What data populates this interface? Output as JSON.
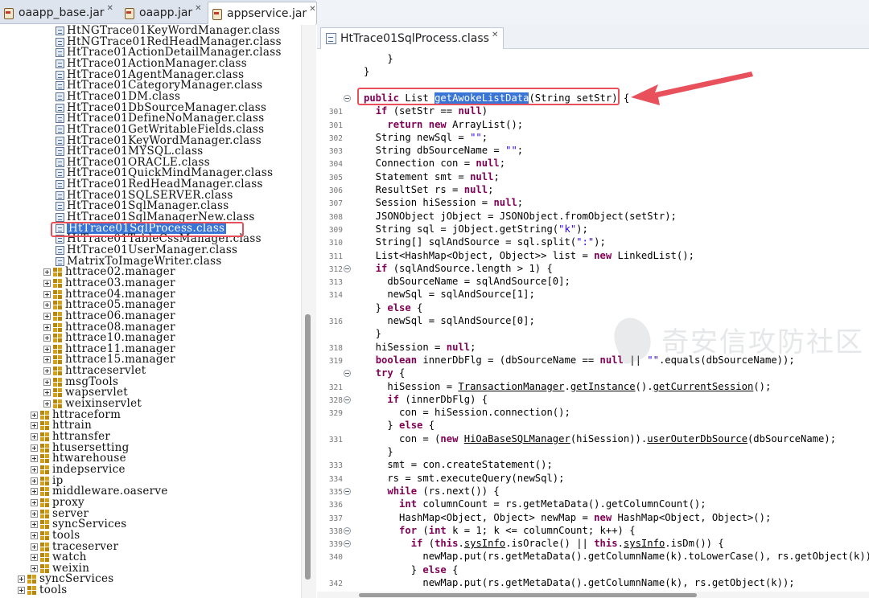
{
  "top_tabs": [
    {
      "label": "oaapp_base.jar",
      "active": false
    },
    {
      "label": "oaapp.jar",
      "active": false
    },
    {
      "label": "appservice.jar",
      "active": true
    }
  ],
  "tree": {
    "class_items": [
      "HtNGTrace01KeyWordManager.class",
      "HtNGTrace01RedHeadManager.class",
      "HtTrace01ActionDetailManager.class",
      "HtTrace01ActionManager.class",
      "HtTrace01AgentManager.class",
      "HtTrace01CategoryManager.class",
      "HtTrace01DM.class",
      "HtTrace01DbSourceManager.class",
      "HtTrace01DefineNoManager.class",
      "HtTrace01GetWritableFields.class",
      "HtTrace01KeyWordManager.class",
      "HtTrace01MYSQL.class",
      "HtTrace01ORACLE.class",
      "HtTrace01QuickMindManager.class",
      "HtTrace01RedHeadManager.class",
      "HtTrace01SQLSERVER.class",
      "HtTrace01SqlManager.class",
      "HtTrace01SqlManagerNew.class",
      "HtTrace01SqlProcess.class",
      "HtTrace01TableCssManager.class",
      "HtTrace01UserManager.class",
      "MatrixToImageWriter.class"
    ],
    "selected_class": "HtTrace01SqlProcess.class",
    "subpackages": [
      "httrace02.manager",
      "httrace03.manager",
      "httrace04.manager",
      "httrace05.manager",
      "httrace06.manager",
      "httrace08.manager",
      "httrace10.manager",
      "httrace11.manager",
      "httrace15.manager",
      "httraceservlet",
      "msgTools",
      "wapservlet",
      "weixinservlet"
    ],
    "packages": [
      "httraceform",
      "httrain",
      "httransfer",
      "htusersetting",
      "htwarehouse",
      "indepservice",
      "ip",
      "middleware.oaserve",
      "proxy",
      "server",
      "syncServices",
      "tools",
      "traceserver",
      "watch",
      "weixin"
    ],
    "root_packages": [
      "syncServices",
      "tools"
    ]
  },
  "editor": {
    "tab_label": "HtTrace01SqlProcess.class",
    "lines": [
      {
        "num": "",
        "fold": false,
        "code": [
          {
            "t": "    }"
          }
        ]
      },
      {
        "num": "",
        "fold": false,
        "code": [
          {
            "t": "}"
          }
        ]
      },
      {
        "num": "",
        "fold": false,
        "code": [
          {
            "t": ""
          }
        ]
      },
      {
        "num": "",
        "fold": true,
        "code": [
          {
            "t": "public",
            "c": "kw"
          },
          {
            "t": " List "
          },
          {
            "t": "getAwokeListData",
            "c": "hl"
          },
          {
            "t": "(String setStr) {"
          }
        ]
      },
      {
        "num": "301",
        "fold": false,
        "code": [
          {
            "t": "  "
          },
          {
            "t": "if",
            "c": "kw"
          },
          {
            "t": " (setStr == "
          },
          {
            "t": "null",
            "c": "kw"
          },
          {
            "t": ")"
          }
        ]
      },
      {
        "num": "301",
        "fold": false,
        "code": [
          {
            "t": "    "
          },
          {
            "t": "return",
            "c": "kw"
          },
          {
            "t": " "
          },
          {
            "t": "new",
            "c": "kw"
          },
          {
            "t": " ArrayList();"
          }
        ]
      },
      {
        "num": "302",
        "fold": false,
        "code": [
          {
            "t": "  String newSql = "
          },
          {
            "t": "\"\"",
            "c": "str"
          },
          {
            "t": ";"
          }
        ]
      },
      {
        "num": "303",
        "fold": false,
        "code": [
          {
            "t": "  String dbSourceName = "
          },
          {
            "t": "\"\"",
            "c": "str"
          },
          {
            "t": ";"
          }
        ]
      },
      {
        "num": "304",
        "fold": false,
        "code": [
          {
            "t": "  Connection con = "
          },
          {
            "t": "null",
            "c": "kw"
          },
          {
            "t": ";"
          }
        ]
      },
      {
        "num": "305",
        "fold": false,
        "code": [
          {
            "t": "  Statement smt = "
          },
          {
            "t": "null",
            "c": "kw"
          },
          {
            "t": ";"
          }
        ]
      },
      {
        "num": "306",
        "fold": false,
        "code": [
          {
            "t": "  ResultSet rs = "
          },
          {
            "t": "null",
            "c": "kw"
          },
          {
            "t": ";"
          }
        ]
      },
      {
        "num": "307",
        "fold": false,
        "code": [
          {
            "t": "  Session hiSession = "
          },
          {
            "t": "null",
            "c": "kw"
          },
          {
            "t": ";"
          }
        ]
      },
      {
        "num": "308",
        "fold": false,
        "code": [
          {
            "t": "  JSONObject jObject = JSONObject.fromObject(setStr);"
          }
        ]
      },
      {
        "num": "309",
        "fold": false,
        "code": [
          {
            "t": "  String sql = jObject.getString("
          },
          {
            "t": "\"k\"",
            "c": "str"
          },
          {
            "t": ");"
          }
        ]
      },
      {
        "num": "310",
        "fold": false,
        "code": [
          {
            "t": "  String[] sqlAndSource = sql.split("
          },
          {
            "t": "\":\"",
            "c": "str"
          },
          {
            "t": ");"
          }
        ]
      },
      {
        "num": "311",
        "fold": false,
        "code": [
          {
            "t": "  List<HashMap<Object, Object>> list = "
          },
          {
            "t": "new",
            "c": "kw"
          },
          {
            "t": " LinkedList();"
          }
        ]
      },
      {
        "num": "312",
        "fold": true,
        "code": [
          {
            "t": "  "
          },
          {
            "t": "if",
            "c": "kw"
          },
          {
            "t": " (sqlAndSource.length > 1) {"
          }
        ]
      },
      {
        "num": "313",
        "fold": false,
        "code": [
          {
            "t": "    dbSourceName = sqlAndSource[0];"
          }
        ]
      },
      {
        "num": "314",
        "fold": false,
        "code": [
          {
            "t": "    newSql = sqlAndSource[1];"
          }
        ]
      },
      {
        "num": "",
        "fold": false,
        "code": [
          {
            "t": "  } "
          },
          {
            "t": "else",
            "c": "kw"
          },
          {
            "t": " {"
          }
        ]
      },
      {
        "num": "316",
        "fold": false,
        "code": [
          {
            "t": "    newSql = sqlAndSource[0];"
          }
        ]
      },
      {
        "num": "",
        "fold": false,
        "code": [
          {
            "t": "  }"
          }
        ]
      },
      {
        "num": "318",
        "fold": false,
        "code": [
          {
            "t": "  hiSession = "
          },
          {
            "t": "null",
            "c": "kw"
          },
          {
            "t": ";"
          }
        ]
      },
      {
        "num": "319",
        "fold": false,
        "code": [
          {
            "t": "  "
          },
          {
            "t": "boolean",
            "c": "kw"
          },
          {
            "t": " innerDbFlg = (dbSourceName == "
          },
          {
            "t": "null",
            "c": "kw"
          },
          {
            "t": " || "
          },
          {
            "t": "\"\"",
            "c": "str"
          },
          {
            "t": ".equals(dbSourceName));"
          }
        ]
      },
      {
        "num": "",
        "fold": true,
        "code": [
          {
            "t": "  "
          },
          {
            "t": "try",
            "c": "kw"
          },
          {
            "t": " {"
          }
        ]
      },
      {
        "num": "321",
        "fold": false,
        "code": [
          {
            "t": "    hiSession = "
          },
          {
            "t": "TransactionManager",
            "c": "ul"
          },
          {
            "t": "."
          },
          {
            "t": "getInstance",
            "c": "ul"
          },
          {
            "t": "()."
          },
          {
            "t": "getCurrentSession",
            "c": "ul"
          },
          {
            "t": "();"
          }
        ]
      },
      {
        "num": "328",
        "fold": true,
        "code": [
          {
            "t": "    "
          },
          {
            "t": "if",
            "c": "kw"
          },
          {
            "t": " (innerDbFlg) {"
          }
        ]
      },
      {
        "num": "329",
        "fold": false,
        "code": [
          {
            "t": "      con = hiSession.connection();"
          }
        ]
      },
      {
        "num": "",
        "fold": false,
        "code": [
          {
            "t": "    } "
          },
          {
            "t": "else",
            "c": "kw"
          },
          {
            "t": " {"
          }
        ]
      },
      {
        "num": "331",
        "fold": false,
        "code": [
          {
            "t": "      con = ("
          },
          {
            "t": "new",
            "c": "kw"
          },
          {
            "t": " "
          },
          {
            "t": "HiOaBaseSQLManager",
            "c": "ul"
          },
          {
            "t": "(hiSession))."
          },
          {
            "t": "userOuterDbSource",
            "c": "ul"
          },
          {
            "t": "(dbSourceName);"
          }
        ]
      },
      {
        "num": "",
        "fold": false,
        "code": [
          {
            "t": "    }"
          }
        ]
      },
      {
        "num": "333",
        "fold": false,
        "code": [
          {
            "t": "    smt = con.createStatement();"
          }
        ]
      },
      {
        "num": "334",
        "fold": false,
        "code": [
          {
            "t": "    rs = smt.executeQuery(newSql);"
          }
        ]
      },
      {
        "num": "335",
        "fold": true,
        "code": [
          {
            "t": "    "
          },
          {
            "t": "while",
            "c": "kw"
          },
          {
            "t": " (rs.next()) {"
          }
        ]
      },
      {
        "num": "336",
        "fold": false,
        "code": [
          {
            "t": "      "
          },
          {
            "t": "int",
            "c": "kw"
          },
          {
            "t": " columnCount = rs.getMetaData().getColumnCount();"
          }
        ]
      },
      {
        "num": "337",
        "fold": false,
        "code": [
          {
            "t": "      HashMap<Object, Object> newMap = "
          },
          {
            "t": "new",
            "c": "kw"
          },
          {
            "t": " HashMap<Object, Object>();"
          }
        ]
      },
      {
        "num": "338",
        "fold": true,
        "code": [
          {
            "t": "      "
          },
          {
            "t": "for",
            "c": "kw"
          },
          {
            "t": " ("
          },
          {
            "t": "int",
            "c": "kw"
          },
          {
            "t": " k = 1; k <= columnCount; k++) {"
          }
        ]
      },
      {
        "num": "339",
        "fold": true,
        "code": [
          {
            "t": "        "
          },
          {
            "t": "if",
            "c": "kw"
          },
          {
            "t": " ("
          },
          {
            "t": "this",
            "c": "kw"
          },
          {
            "t": "."
          },
          {
            "t": "sysInfo",
            "c": "ul"
          },
          {
            "t": ".isOracle() || "
          },
          {
            "t": "this",
            "c": "kw"
          },
          {
            "t": "."
          },
          {
            "t": "sysInfo",
            "c": "ul"
          },
          {
            "t": ".isDm()) {"
          }
        ]
      },
      {
        "num": "340",
        "fold": false,
        "code": [
          {
            "t": "          newMap.put(rs.getMetaData().getColumnName(k).toLowerCase(), rs.getObject(k));"
          }
        ]
      },
      {
        "num": "",
        "fold": false,
        "code": [
          {
            "t": "        } "
          },
          {
            "t": "else",
            "c": "kw"
          },
          {
            "t": " {"
          }
        ]
      },
      {
        "num": "342",
        "fold": false,
        "code": [
          {
            "t": "          newMap.put(rs.getMetaData().getColumnName(k), rs.getObject(k));"
          }
        ]
      }
    ]
  },
  "colors": {
    "keyword": "#7f0055",
    "string": "#2a00ff",
    "selection": "#3875d7",
    "annotation_red": "#e8505b"
  }
}
